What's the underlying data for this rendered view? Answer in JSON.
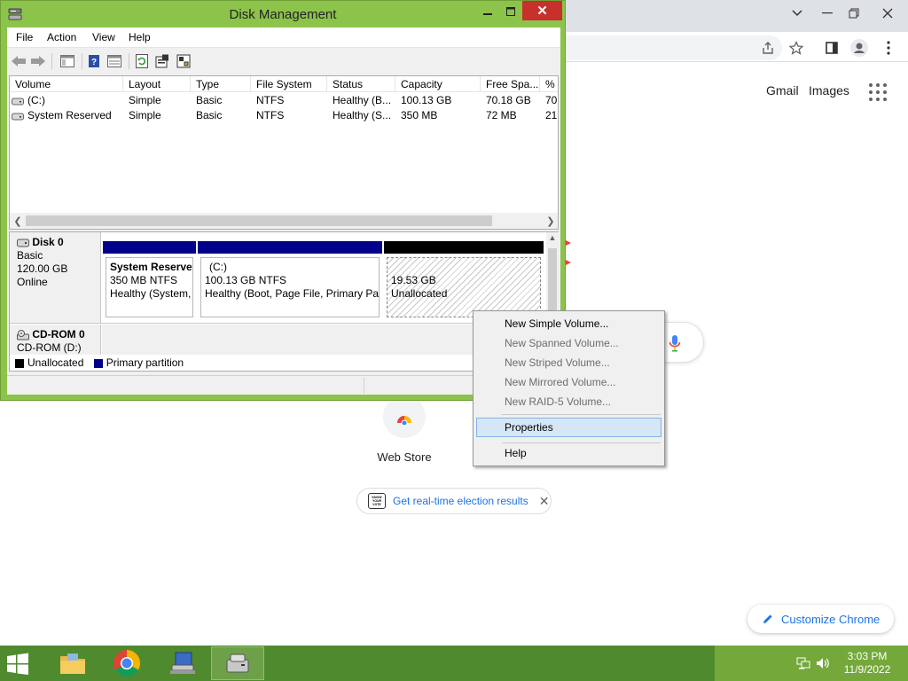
{
  "chrome": {
    "links": [
      "Gmail",
      "Images"
    ],
    "shortcut_label": "Web Store",
    "chip_label": "Get real-time election results",
    "chip_badge": "KNOW YOUR VOTE",
    "customize_label": "Customize Chrome",
    "accent_color": "#1a73e8"
  },
  "dm": {
    "title": "Disk Management",
    "menu": [
      "File",
      "Action",
      "View",
      "Help"
    ],
    "columns": [
      "Volume",
      "Layout",
      "Type",
      "File System",
      "Status",
      "Capacity",
      "Free Spa...",
      "% F"
    ],
    "rows": [
      [
        "(C:)",
        "Simple",
        "Basic",
        "NTFS",
        "Healthy (B...",
        "100.13 GB",
        "70.18 GB",
        "70"
      ],
      [
        "System Reserved",
        "Simple",
        "Basic",
        "NTFS",
        "Healthy (S...",
        "350 MB",
        "72 MB",
        "21"
      ]
    ],
    "disks": [
      {
        "name": "Disk 0",
        "lines": [
          "Basic",
          "120.00 GB",
          "Online"
        ],
        "partitions": [
          {
            "title": "System Reserve",
            "lines": [
              "350 MB NTFS",
              "Healthy (System,"
            ]
          },
          {
            "title": "(C:)",
            "lines": [
              "100.13 GB NTFS",
              "Healthy (Boot, Page File, Primary Par"
            ]
          },
          {
            "title": "",
            "lines": [
              "19.53 GB",
              "Unallocated"
            ]
          }
        ]
      },
      {
        "name": "CD-ROM 0",
        "lines": [
          "CD-ROM (D:)"
        ]
      }
    ],
    "legend": [
      "Unallocated",
      "Primary partition"
    ],
    "colors": {
      "primary_partition": "#00008b",
      "unallocated": "#000000",
      "window_frame": "#8cc34b",
      "close_button": "#c7302b"
    }
  },
  "context_menu": {
    "items": [
      {
        "label": "New Simple Volume...",
        "enabled": true
      },
      {
        "label": "New Spanned Volume...",
        "enabled": false
      },
      {
        "label": "New Striped Volume...",
        "enabled": false
      },
      {
        "label": "New Mirrored Volume...",
        "enabled": false
      },
      {
        "label": "New RAID-5 Volume...",
        "enabled": false
      },
      {
        "label": "Properties",
        "enabled": true,
        "highlighted": true
      },
      {
        "label": "Help",
        "enabled": true
      }
    ]
  },
  "taskbar": {
    "time": "3:03 PM",
    "date": "11/9/2022"
  }
}
